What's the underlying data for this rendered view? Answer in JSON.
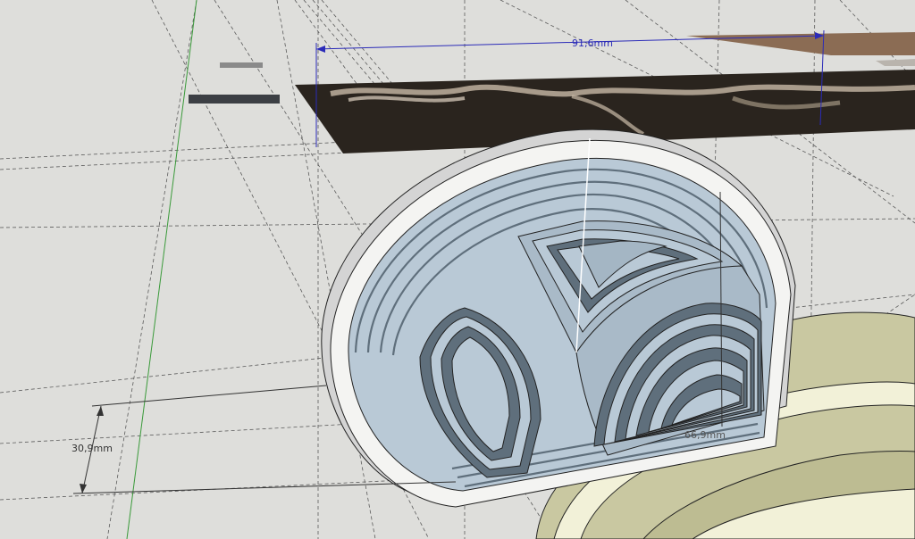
{
  "viewport": {
    "background": "#dededb",
    "guide_color": "#5a5a5a",
    "axis_color": "#3a9a3a"
  },
  "model": {
    "face_color": "#b9c9d6",
    "face_side_color": "#9fb2c2",
    "groove_color": "#5f6f7c",
    "rim_color": "#f4f4f2",
    "side_color": "#d4d4d4",
    "ring_color": "#c9c8a1",
    "ring_light_color": "#f2f1d8"
  },
  "reference_image": {
    "color": "#2a241e"
  },
  "dimensions": {
    "width_label": "91,6mm",
    "height_label": "30,9mm",
    "depth_label": "66,9mm",
    "width_color": "#2b2bb8",
    "height_color": "#333333"
  }
}
